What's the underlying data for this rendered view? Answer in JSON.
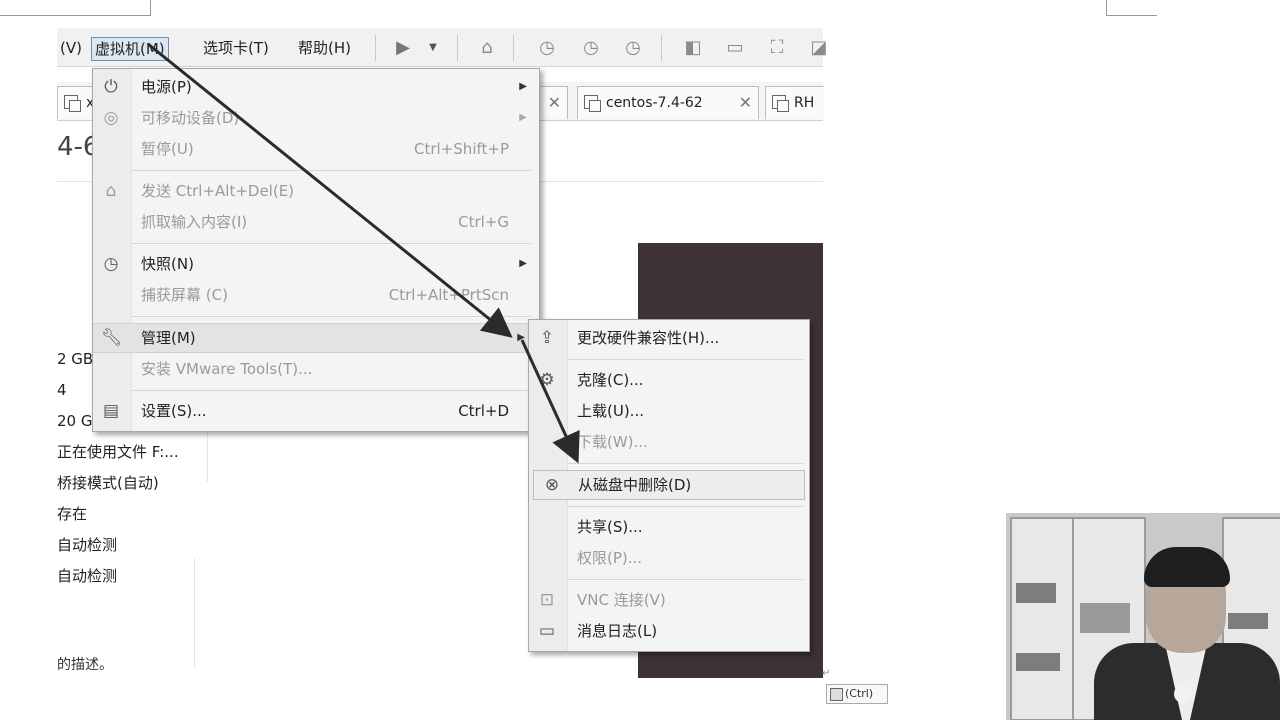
{
  "toolbar": {
    "menus": [
      "(V)",
      "虚拟机(M)",
      "选项卡(T)",
      "帮助(H)"
    ]
  },
  "tabs": [
    {
      "label": "x",
      "close": ""
    },
    {
      "label": "",
      "close": "✕"
    },
    {
      "label": "centos-7.4-62",
      "close": "✕"
    },
    {
      "label": "RH",
      "close": ""
    }
  ],
  "vm": {
    "title": "4-6",
    "details": [
      "2 GB",
      "4",
      "20 G",
      "正在使用文件 F:...",
      "桥接模式(自动)",
      "存在",
      "自动检测",
      "自动检测"
    ],
    "description": "的描述。"
  },
  "main_menu": {
    "items": [
      {
        "icon": "power-icon",
        "label": "电源(P)",
        "shortcut": "",
        "submenu": true,
        "disabled": false
      },
      {
        "icon": "disc-icon",
        "label": "可移动设备(D)",
        "shortcut": "",
        "submenu": true,
        "disabled": true
      },
      {
        "icon": "",
        "label": "暂停(U)",
        "shortcut": "Ctrl+Shift+P",
        "submenu": false,
        "disabled": true
      },
      {
        "icon": "keyboard-send-icon",
        "label": "发送 Ctrl+Alt+Del(E)",
        "shortcut": "",
        "submenu": false,
        "disabled": true
      },
      {
        "icon": "",
        "label": "抓取输入内容(I)",
        "shortcut": "Ctrl+G",
        "submenu": false,
        "disabled": true
      },
      {
        "icon": "snapshot-icon",
        "label": "快照(N)",
        "shortcut": "",
        "submenu": true,
        "disabled": false
      },
      {
        "icon": "",
        "label": "捕获屏幕 (C)",
        "shortcut": "Ctrl+Alt+PrtScn",
        "submenu": false,
        "disabled": true
      },
      {
        "icon": "wrench-icon",
        "label": "管理(M)",
        "shortcut": "",
        "submenu": true,
        "disabled": false
      },
      {
        "icon": "",
        "label": "安装 VMware Tools(T)...",
        "shortcut": "",
        "submenu": false,
        "disabled": true
      },
      {
        "icon": "settings-icon",
        "label": "设置(S)...",
        "shortcut": "Ctrl+D",
        "submenu": false,
        "disabled": false
      }
    ]
  },
  "manage_submenu": {
    "items": [
      {
        "icon": "hardware-compat-icon",
        "label": "更改硬件兼容性(H)...",
        "disabled": false
      },
      {
        "icon": "clone-icon",
        "label": "克隆(C)...",
        "disabled": false
      },
      {
        "icon": "",
        "label": "上载(U)...",
        "disabled": false
      },
      {
        "icon": "",
        "label": "下载(W)...",
        "disabled": true
      },
      {
        "icon": "delete-disk-icon",
        "label": "从磁盘中删除(D)",
        "disabled": false
      },
      {
        "icon": "",
        "label": "共享(S)...",
        "disabled": false
      },
      {
        "icon": "",
        "label": "权限(P)...",
        "disabled": true
      },
      {
        "icon": "vnc-icon",
        "label": "VNC 连接(V)",
        "disabled": true
      },
      {
        "icon": "message-log-icon",
        "label": "消息日志(L)",
        "disabled": false
      }
    ]
  },
  "paste_tag": {
    "label": "(Ctrl)"
  },
  "colors": {
    "menu_bg": "#f4f4f4",
    "highlight": "#e3e3e3",
    "dark_panel": "#3f3237",
    "arrow": "#2b2b2b"
  }
}
